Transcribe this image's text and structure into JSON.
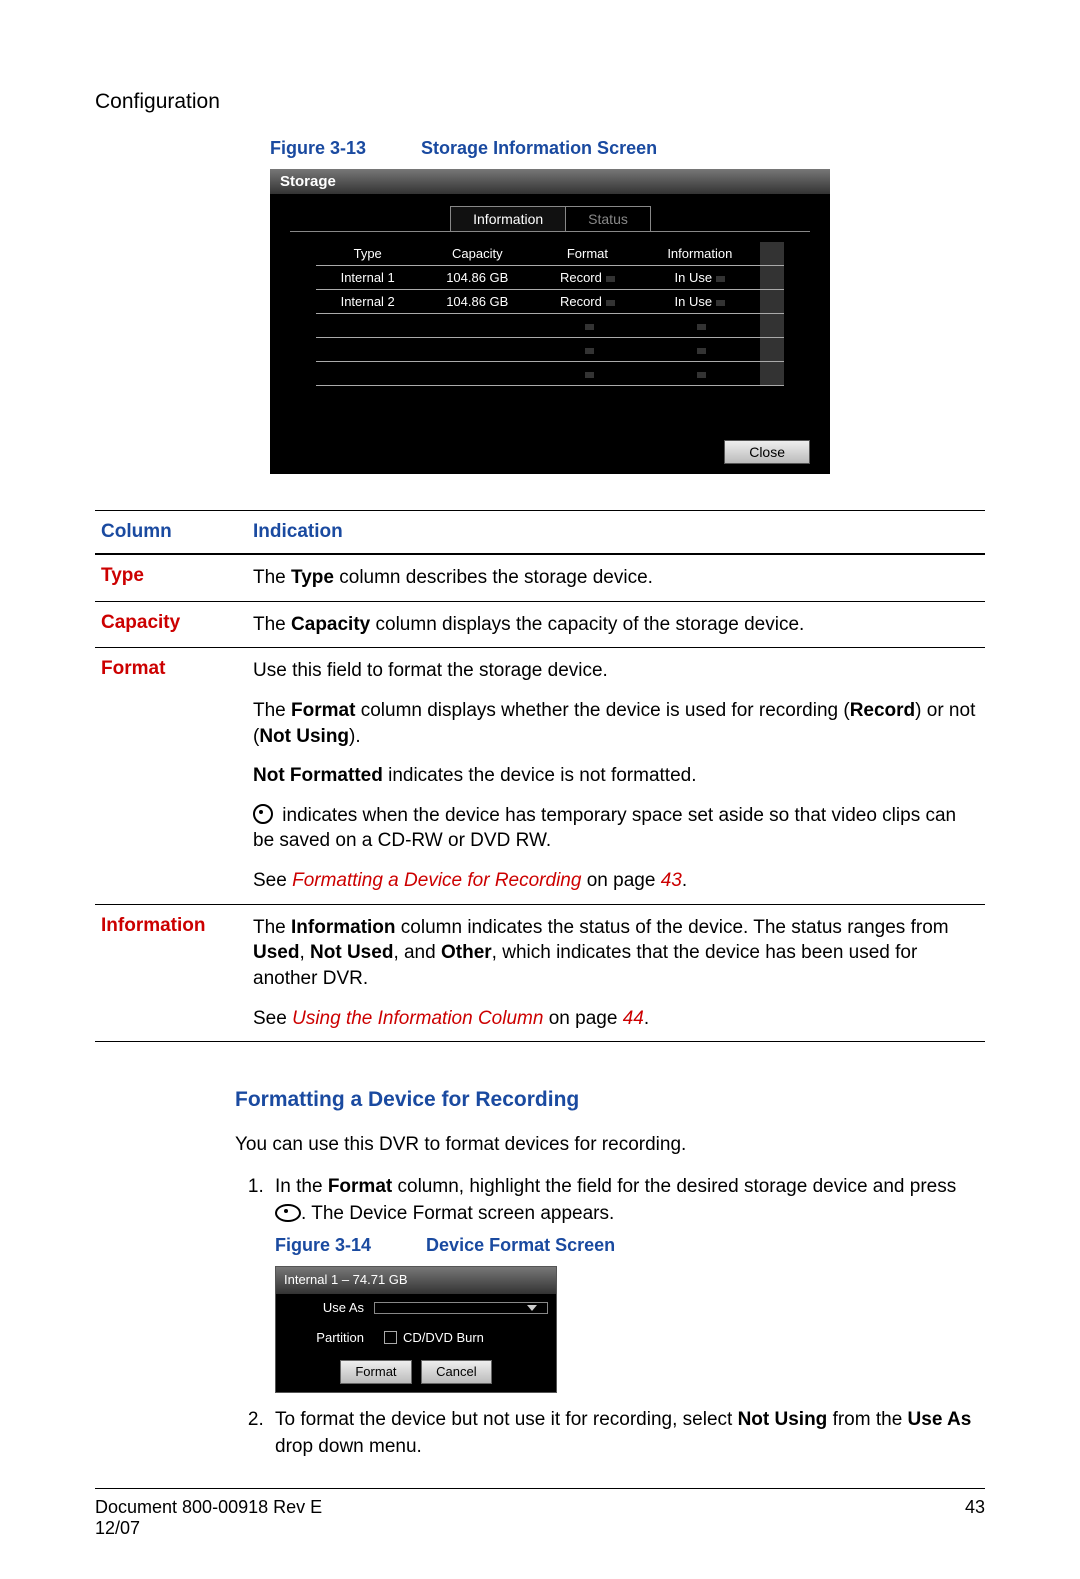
{
  "section": "Configuration",
  "fig13": {
    "num": "Figure 3-13",
    "title": "Storage Information Screen"
  },
  "ss": {
    "title": "Storage",
    "tabs": [
      "Information",
      "Status"
    ],
    "headers": [
      "Type",
      "Capacity",
      "Format",
      "Information"
    ],
    "rows": [
      {
        "type": "Internal 1",
        "capacity": "104.86 GB",
        "format": "Record",
        "info": "In Use"
      },
      {
        "type": "Internal 2",
        "capacity": "104.86 GB",
        "format": "Record",
        "info": "In Use"
      }
    ],
    "close": "Close"
  },
  "coltable": {
    "headers": [
      "Column",
      "Indication"
    ],
    "type": {
      "label": "Type",
      "p1a": "The ",
      "p1b": "Type",
      "p1c": " column describes the storage device."
    },
    "capacity": {
      "label": "Capacity",
      "p1a": "The ",
      "p1b": "Capacity",
      "p1c": " column displays the capacity of the storage device."
    },
    "format": {
      "label": "Format",
      "p1": "Use this field to format the storage device.",
      "p2a": "The ",
      "p2b": "Format",
      "p2c": " column displays whether the device is used for recording (",
      "p2d": "Record",
      "p2e": ") or not (",
      "p2f": "Not Using",
      "p2g": ").",
      "p3a": "Not Formatted",
      "p3b": " indicates the device is not formatted.",
      "p4": " indicates when the device has temporary space set aside so that video clips can be saved on a CD-RW or DVD RW.",
      "p5a": "See ",
      "p5b": "Formatting a Device for Recording",
      "p5c": " on page ",
      "p5d": "43",
      "p5e": "."
    },
    "information": {
      "label": "Information",
      "p1a": "The ",
      "p1b": "Information",
      "p1c": " column indicates the status of the device. The status ranges from ",
      "p1d": "Used",
      "p1e": ", ",
      "p1f": "Not Used",
      "p1g": ", and ",
      "p1h": "Other",
      "p1i": ", which indicates that the device has been used for another DVR.",
      "p2a": "See ",
      "p2b": "Using the Information Column",
      "p2c": " on page ",
      "p2d": "44",
      "p2e": "."
    }
  },
  "subhead": "Formatting a Device for Recording",
  "intro": "You can use this DVR to format devices for recording.",
  "step1a": "In the ",
  "step1b": "Format",
  "step1c": " column, highlight the field for the desired storage device and press ",
  "step1d": ". The Device Format screen appears.",
  "fig14": {
    "num": "Figure 3-14",
    "title": "Device Format Screen"
  },
  "devfmt": {
    "head": "Internal 1 – 74.71 GB",
    "useas_label": "Use As",
    "partition_label": "Partition",
    "partition_value": "CD/DVD Burn",
    "format_btn": "Format",
    "cancel_btn": "Cancel"
  },
  "step2a": "To format the device but not use it for recording, select ",
  "step2b": "Not Using",
  "step2c": " from the ",
  "step2d": "Use As",
  "step2e": " drop down menu.",
  "footer": {
    "doc": "Document 800-00918 Rev E",
    "date": "12/07",
    "page": "43"
  }
}
